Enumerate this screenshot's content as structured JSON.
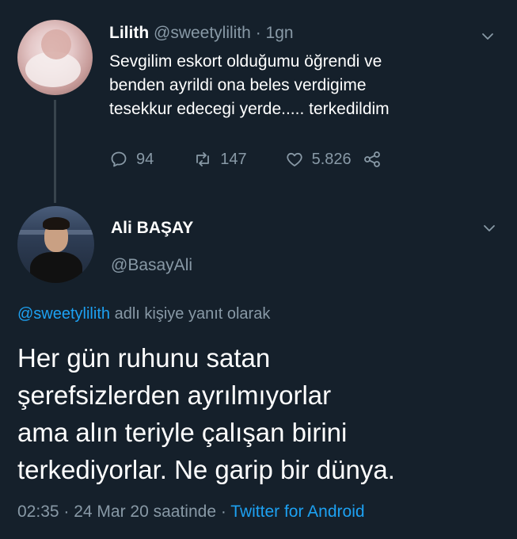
{
  "colors": {
    "background": "#15202b",
    "muted": "#8899a6",
    "link": "#1da1f2",
    "text": "#ffffff"
  },
  "tweet1": {
    "name": "Lilith",
    "handle": "@sweetylilith",
    "separator": "·",
    "time": "1gn",
    "text": "Sevgilim eskort olduğumu öğrendi ve\nbenden ayrildi ona beles verdigime\ntesekkur edecegi yerde..... terkedildim",
    "replies": "94",
    "retweets": "147",
    "likes": "5.826",
    "icons": [
      "reply-icon",
      "retweet-icon",
      "like-icon",
      "share-icon",
      "chevron-down-icon"
    ]
  },
  "tweet2": {
    "name": "Ali BAŞAY",
    "handle": "@BasayAli",
    "reply_to_handle": "@sweetylilith",
    "reply_to_suffix": "adlı kişiye yanıt olarak",
    "text": "Her gün ruhunu satan\nşerefsizlerden ayrılmıyorlar\nama alın teriyle çalışan birini\nterkediyorlar. Ne garip bir dünya.",
    "timestamp": "02:35 · 24 Mar 20 saatinde ·",
    "source": "Twitter for Android"
  }
}
